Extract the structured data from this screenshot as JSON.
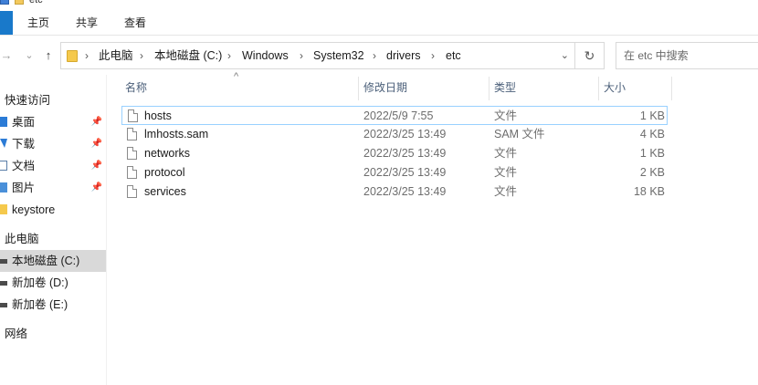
{
  "window": {
    "title": "etc"
  },
  "ribbon": {
    "tabs": [
      "主页",
      "共享",
      "查看"
    ]
  },
  "nav_buttons": {
    "back": "←",
    "forward": "→",
    "recent": "⌄",
    "up": "↑",
    "refresh": "↻",
    "dropdown": "⌄"
  },
  "address": {
    "crumbs": [
      "此电脑",
      "本地磁盘 (C:)",
      "Windows",
      "System32",
      "drivers",
      "etc"
    ],
    "separator": "›"
  },
  "search": {
    "placeholder": "在 etc 中搜索"
  },
  "sidebar": {
    "quick_access": "快速访问",
    "pinned": [
      {
        "label": "桌面",
        "icon": "desktop-icon"
      },
      {
        "label": "下载",
        "icon": "download-icon"
      },
      {
        "label": "文档",
        "icon": "document-icon"
      },
      {
        "label": "图片",
        "icon": "pictures-icon"
      }
    ],
    "pin_glyph": "📌",
    "folders": [
      {
        "label": "keystore",
        "icon": "folder-icon"
      }
    ],
    "this_pc": "此电脑",
    "drives": [
      {
        "label": "本地磁盘 (C:)",
        "selected": true
      },
      {
        "label": "新加卷 (D:)",
        "selected": false
      },
      {
        "label": "新加卷 (E:)",
        "selected": false
      }
    ],
    "network": "网络"
  },
  "columns": {
    "name": "名称",
    "modified": "修改日期",
    "type": "类型",
    "size": "大小",
    "sort_glyph": "^"
  },
  "files": [
    {
      "name": "hosts",
      "modified": "2022/5/9 7:55",
      "type": "文件",
      "size": "1 KB",
      "focused": true
    },
    {
      "name": "lmhosts.sam",
      "modified": "2022/3/25 13:49",
      "type": "SAM 文件",
      "size": "4 KB",
      "focused": false
    },
    {
      "name": "networks",
      "modified": "2022/3/25 13:49",
      "type": "文件",
      "size": "1 KB",
      "focused": false
    },
    {
      "name": "protocol",
      "modified": "2022/3/25 13:49",
      "type": "文件",
      "size": "2 KB",
      "focused": false
    },
    {
      "name": "services",
      "modified": "2022/3/25 13:49",
      "type": "文件",
      "size": "18 KB",
      "focused": false
    }
  ],
  "colors": {
    "accent": "#1979ca",
    "selection": "#d9d9d9",
    "focus_border": "#99d1ff",
    "header_text": "#4c607a"
  }
}
